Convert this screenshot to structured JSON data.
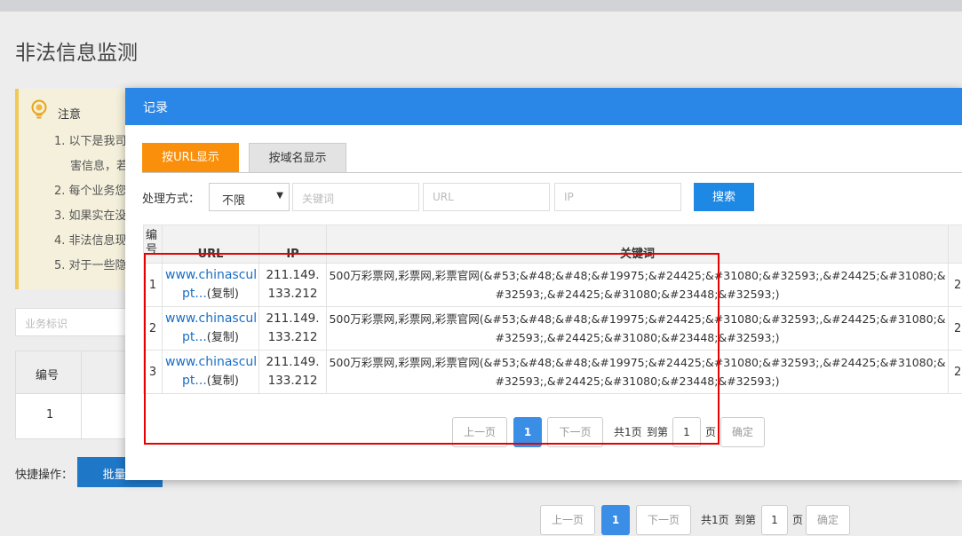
{
  "background": {
    "page_title": "非法信息监测",
    "notice": {
      "title": "注意",
      "lines": [
        "1. 以下是我司",
        "害信息，若",
        "2. 每个业务您",
        "3. 如果实在没",
        "4. 非法信息现",
        "5. 对于一些隐"
      ]
    },
    "search_placeholder": "业务标识",
    "table": {
      "col_num": "编号",
      "row1_num": "1"
    },
    "quick_ops_label": "快捷操作：",
    "bulk_button": "批量导",
    "pager": {
      "prev": "上一页",
      "current": "1",
      "next": "下一页",
      "total": "共1页",
      "goto_prefix": "到第",
      "goto_value": "1",
      "goto_suffix": "页",
      "confirm": "确定"
    }
  },
  "modal": {
    "title": "记录",
    "tabs": [
      {
        "label": "按URL显示",
        "active": true
      },
      {
        "label": "按域名显示",
        "active": false
      }
    ],
    "filter": {
      "label": "处理方式：",
      "select_value": "不限",
      "keyword_placeholder": "关键词",
      "url_placeholder": "URL",
      "ip_placeholder": "IP",
      "search_button": "搜索"
    },
    "table": {
      "headers": {
        "num": "编号",
        "url": "URL",
        "ip": "IP",
        "keywords": "关键词"
      },
      "rows": [
        {
          "num": "1",
          "url_line1": "www.chinascul",
          "url_line2": "pt...",
          "copy": "(复制)",
          "ip": "211.149.133.212",
          "keywords": "500万彩票网,彩票网,彩票官网(&#53;&#48;&#48;&#19975;&#24425;&#31080;&#32593;,&#24425;&#31080;&#32593;,&#24425;&#31080;&#23448;&#32593;)",
          "extra": "2"
        },
        {
          "num": "2",
          "url_line1": "www.chinascul",
          "url_line2": "pt...",
          "copy": "(复制)",
          "ip": "211.149.133.212",
          "keywords": "500万彩票网,彩票网,彩票官网(&#53;&#48;&#48;&#19975;&#24425;&#31080;&#32593;,&#24425;&#31080;&#32593;,&#24425;&#31080;&#23448;&#32593;)",
          "extra": "2"
        },
        {
          "num": "3",
          "url_line1": "www.chinascul",
          "url_line2": "pt...",
          "copy": "(复制)",
          "ip": "211.149.133.212",
          "keywords": "500万彩票网,彩票网,彩票官网(&#53;&#48;&#48;&#19975;&#24425;&#31080;&#32593;,&#24425;&#31080;&#32593;,&#24425;&#31080;&#23448;&#32593;)",
          "extra": "2"
        }
      ]
    },
    "pager": {
      "prev": "上一页",
      "current": "1",
      "next": "下一页",
      "total": "共1页",
      "goto_prefix": "到第",
      "goto_value": "1",
      "goto_suffix": "页",
      "confirm": "确定"
    }
  },
  "colors": {
    "header_blue": "#2a87e8",
    "tab_orange": "#f98f0a",
    "button_blue": "#1e88e5",
    "highlight_red": "#e60000",
    "link_blue": "#1a6fc4"
  }
}
